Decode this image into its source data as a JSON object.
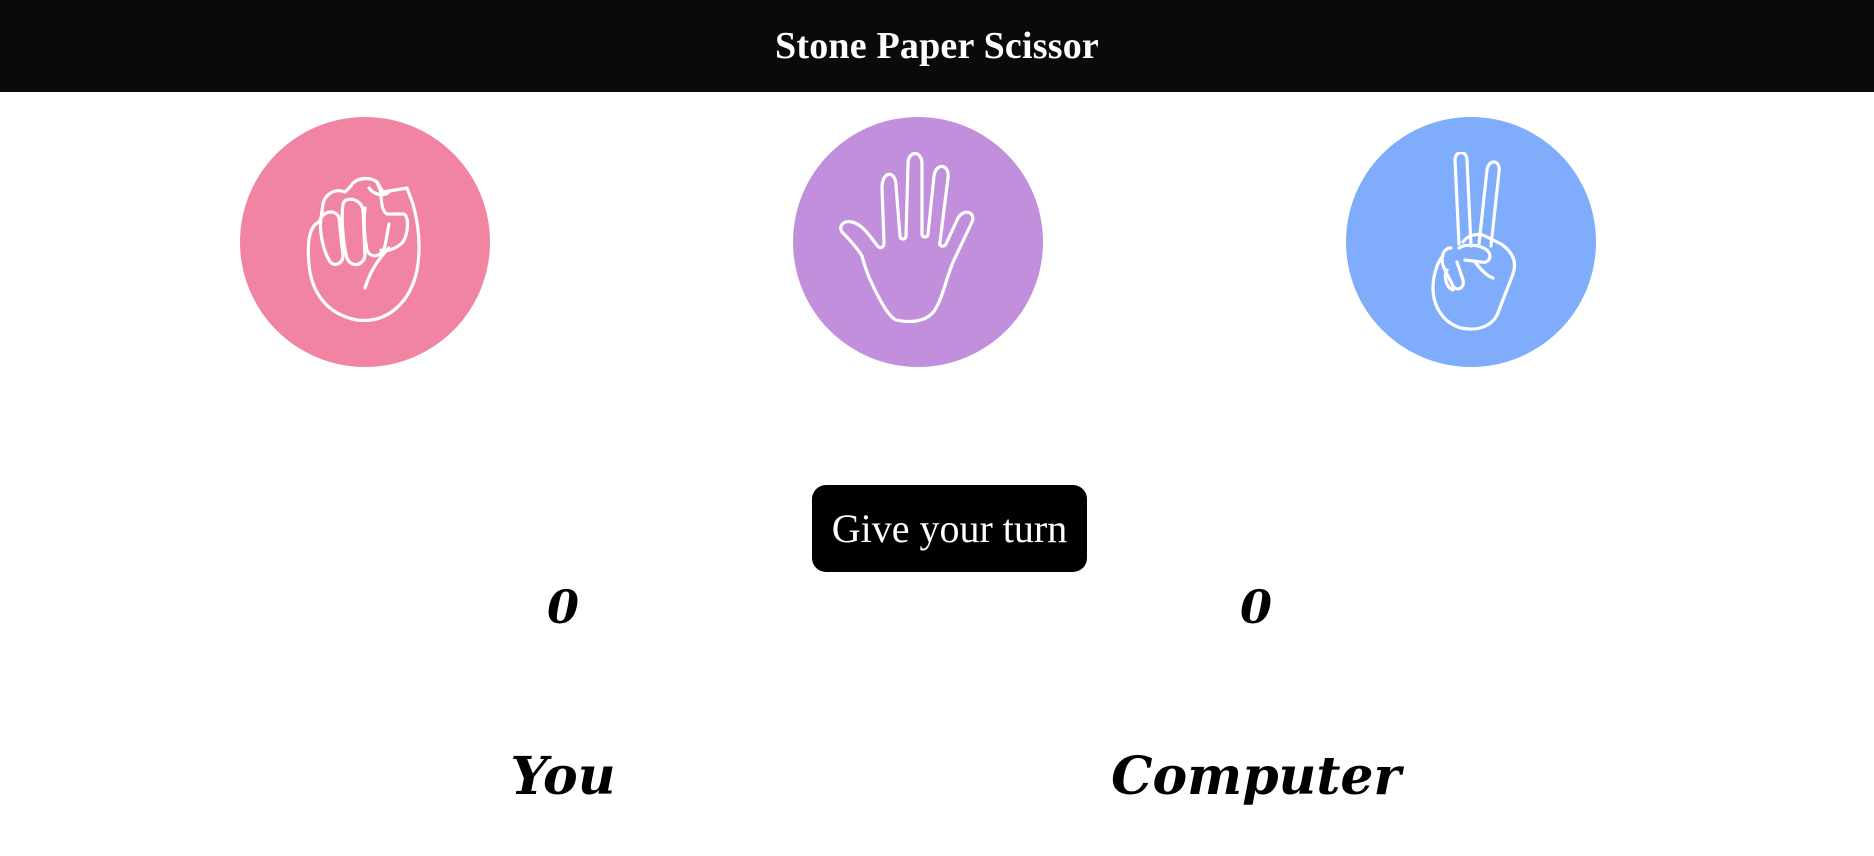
{
  "header": {
    "title": "Stone Paper Scissor",
    "background": "#0a0a0a"
  },
  "choices": [
    {
      "id": "stone",
      "icon": "fist-icon",
      "color": "#f084a2"
    },
    {
      "id": "paper",
      "icon": "open-hand-icon",
      "color": "#c28fdd"
    },
    {
      "id": "scissor",
      "icon": "victory-hand-icon",
      "color": "#80acfc"
    }
  ],
  "action": {
    "turn_label": "Give your turn"
  },
  "scoreboard": {
    "user_score": "0",
    "computer_score": "0",
    "user_label": "You",
    "computer_label": "Computer"
  }
}
